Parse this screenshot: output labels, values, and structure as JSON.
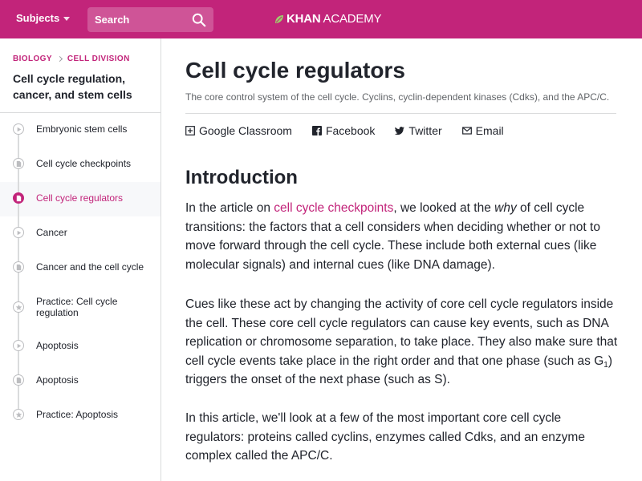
{
  "header": {
    "subjects_label": "Subjects",
    "search_placeholder": "Search",
    "brand_bold": "KHAN",
    "brand_light": "ACADEMY"
  },
  "sidebar": {
    "breadcrumb": [
      "BIOLOGY",
      "CELL DIVISION"
    ],
    "unit_title": "Cell cycle regulation, cancer, and stem cells",
    "lessons": [
      {
        "label": "Embryonic stem cells",
        "icon": "play-icon"
      },
      {
        "label": "Cell cycle checkpoints",
        "icon": "article-icon"
      },
      {
        "label": "Cell cycle regulators",
        "icon": "article-icon",
        "active": true
      },
      {
        "label": "Cancer",
        "icon": "play-icon"
      },
      {
        "label": "Cancer and the cell cycle",
        "icon": "article-icon"
      },
      {
        "label": "Practice: Cell cycle regulation",
        "icon": "star-icon"
      },
      {
        "label": "Apoptosis",
        "icon": "play-icon"
      },
      {
        "label": "Apoptosis",
        "icon": "article-icon"
      },
      {
        "label": "Practice: Apoptosis",
        "icon": "star-icon"
      }
    ]
  },
  "main": {
    "title": "Cell cycle regulators",
    "description": "The core control system of the cell cycle. Cyclins, cyclin-dependent kinases (Cdks), and the APC/C.",
    "share": [
      "Google Classroom",
      "Facebook",
      "Twitter",
      "Email"
    ],
    "section_heading": "Introduction",
    "p1": {
      "pre": "In the article on ",
      "link": "cell cycle checkpoints",
      "mid": ", we looked at the ",
      "em": "why",
      "post": " of cell cycle transitions: the factors that a cell considers when deciding whether or not to move forward through the cell cycle. These include both external cues (like molecular signals) and internal cues (like DNA damage)."
    },
    "p2": {
      "pre": "Cues like these act by changing the activity of core cell cycle regulators inside the cell. These core cell cycle regulators can cause key events, such as DNA replication or chromosome separation, to take place. They also make sure that cell cycle events take place in the right order and that one phase (such as G",
      "sub": "1",
      "post": ") triggers the onset of the next phase (such as S)."
    },
    "p3": "In this article, we'll look at a few of the most important core cell cycle regulators: proteins called cyclins, enzymes called Cdks, and an enzyme complex called the APC/C."
  },
  "colors": {
    "brand": "#c2247a",
    "text": "#21242c",
    "muted": "#626569",
    "border": "#dadbdc"
  }
}
